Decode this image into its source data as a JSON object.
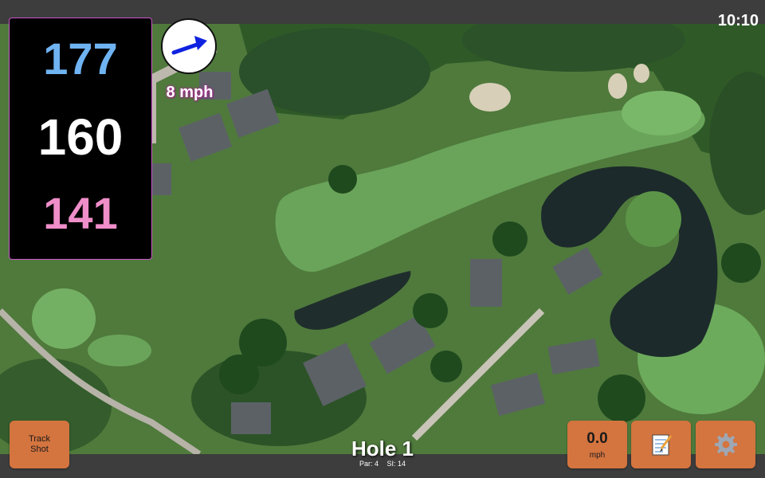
{
  "status": {
    "time": "10:10"
  },
  "distances": {
    "back": "177",
    "middle": "160",
    "front": "141",
    "colors": {
      "back": "#6fb3f2",
      "middle": "#ffffff",
      "front": "#ef8ec9"
    }
  },
  "wind": {
    "speed": "8 mph",
    "icon": "arrow-right-icon"
  },
  "hole": {
    "title": "Hole 1",
    "par": "Par: 4",
    "si": "SI: 14"
  },
  "buttons": {
    "track_shot": {
      "line1": "Track",
      "line2": "Shot"
    },
    "speed": {
      "value": "0.0",
      "unit": "mph"
    },
    "notes_icon": "notepad-icon",
    "settings_icon": "gear-icon",
    "accent": "#d4743f"
  }
}
